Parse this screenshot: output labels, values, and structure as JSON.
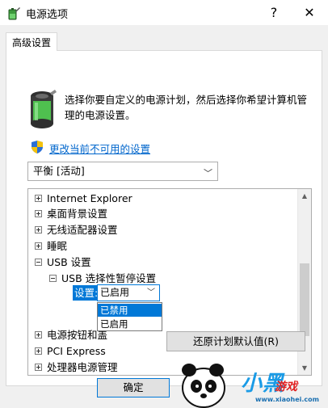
{
  "window": {
    "title": "电源选项",
    "help_label": "?",
    "close_label": "✕"
  },
  "tab": {
    "label": "高级设置"
  },
  "description": "选择你要自定义的电源计划，然后选择你希望计算机管理的电源设置。",
  "change_link": "更改当前不可用的设置",
  "plan_select": {
    "value": "平衡 [活动]"
  },
  "tree": {
    "items": [
      {
        "label": "Internet Explorer",
        "expander": "+"
      },
      {
        "label": "桌面背景设置",
        "expander": "+"
      },
      {
        "label": "无线适配器设置",
        "expander": "+"
      },
      {
        "label": "睡眠",
        "expander": "+"
      },
      {
        "label": "USB 设置",
        "expander": "−"
      },
      {
        "label": "USB 选择性暂停设置",
        "expander": "−"
      },
      {
        "label": "电源按钮和盖",
        "expander": "+"
      },
      {
        "label": "PCI Express",
        "expander": "+"
      },
      {
        "label": "处理器电源管理",
        "expander": "+"
      }
    ],
    "setting_label": "设置:",
    "setting_value": "已启用",
    "dropdown_options": [
      {
        "label": "已禁用",
        "selected": true
      },
      {
        "label": "已启用",
        "selected": false
      }
    ]
  },
  "restore_button": "还原计划默认值(R)",
  "ok_button": "确定",
  "watermark": {
    "text1": "小黑",
    "text2": "游戏",
    "url": "www.xiaohei.com"
  },
  "colors": {
    "accent": "#0078d7",
    "link": "#0066cc"
  }
}
